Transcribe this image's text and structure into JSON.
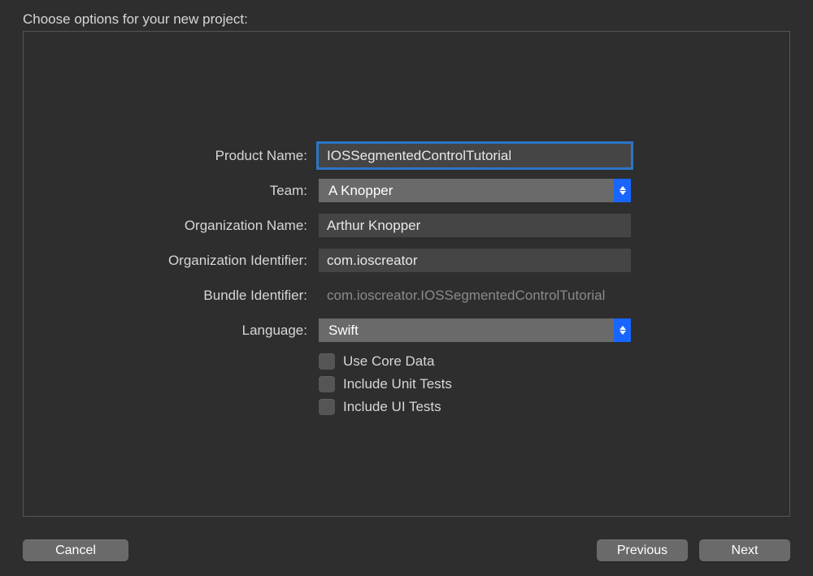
{
  "header": {
    "title": "Choose options for your new project:"
  },
  "form": {
    "productName": {
      "label": "Product Name:",
      "value": "IOSSegmentedControlTutorial"
    },
    "team": {
      "label": "Team:",
      "value": "A Knopper"
    },
    "orgName": {
      "label": "Organization Name:",
      "value": "Arthur Knopper"
    },
    "orgIdentifier": {
      "label": "Organization Identifier:",
      "value": "com.ioscreator"
    },
    "bundleIdentifier": {
      "label": "Bundle Identifier:",
      "value": "com.ioscreator.IOSSegmentedControlTutorial"
    },
    "language": {
      "label": "Language:",
      "value": "Swift"
    },
    "useCoreData": {
      "label": "Use Core Data"
    },
    "includeUnitTests": {
      "label": "Include Unit Tests"
    },
    "includeUITests": {
      "label": "Include UI Tests"
    }
  },
  "footer": {
    "cancel": "Cancel",
    "previous": "Previous",
    "next": "Next"
  }
}
